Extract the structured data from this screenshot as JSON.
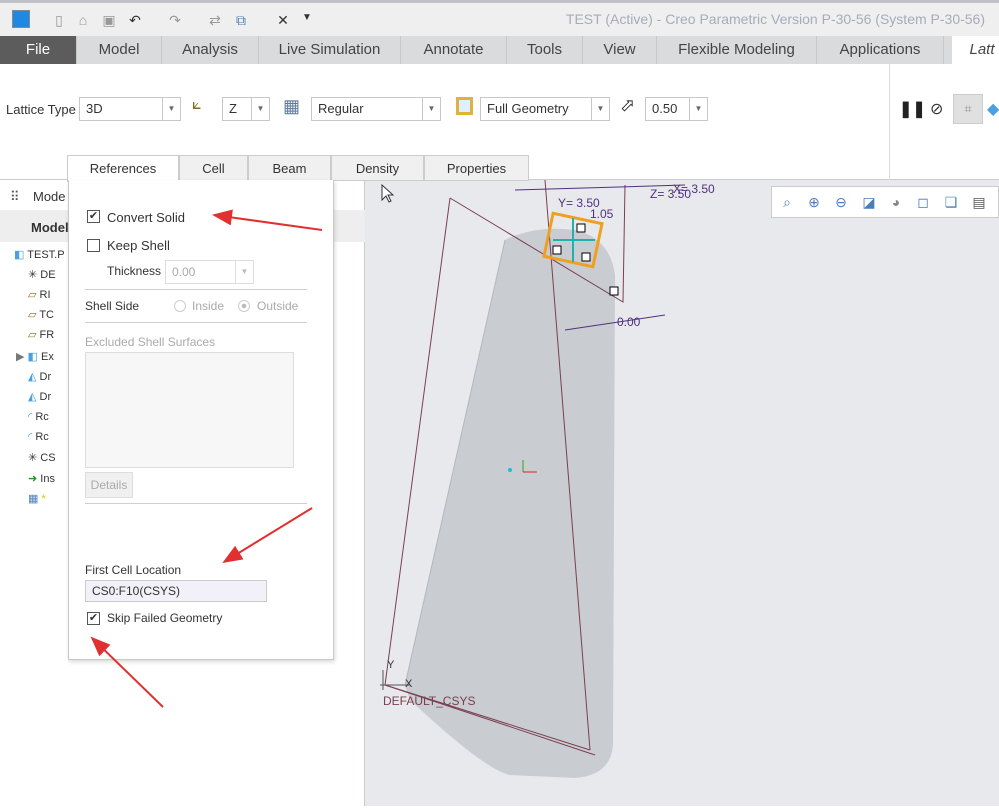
{
  "window": {
    "title": "TEST (Active) - Creo Parametric Version P-30-56 (System P-30-56)"
  },
  "tabs": [
    "File",
    "Model",
    "Analysis",
    "Live Simulation",
    "Annotate",
    "Tools",
    "View",
    "Flexible Modeling",
    "Applications",
    "Latt"
  ],
  "ribbon": {
    "lattice_type_label": "Lattice Type",
    "lattice_type": "3D",
    "direction": "Z",
    "cell_type": "Regular",
    "geometry": "Full Geometry",
    "scale": "0.50"
  },
  "panel_tabs": [
    "References",
    "Cell",
    "Beam",
    "Density",
    "Properties"
  ],
  "references": {
    "convert_solid": "Convert Solid",
    "convert_solid_checked": true,
    "keep_shell": "Keep Shell",
    "keep_shell_checked": false,
    "thickness_label": "Thickness",
    "thickness": "0.00",
    "shell_side_label": "Shell Side",
    "inside": "Inside",
    "outside": "Outside",
    "shell_side_selected": "Outside",
    "excluded_label": "Excluded Shell Surfaces",
    "details": "Details",
    "first_cell_label": "First Cell Location",
    "first_cell_value": "CS0:F10(CSYS)",
    "skip_failed": "Skip Failed Geometry",
    "skip_failed_checked": true
  },
  "tree": {
    "header": "Mode",
    "tab": "Model",
    "items": [
      "TEST.P",
      "DE",
      "RI",
      "TC",
      "FR",
      "Ex",
      "Dr",
      "Dr",
      "Rc",
      "Rc",
      "CS",
      "Ins",
      "*"
    ]
  },
  "viewport": {
    "dims": [
      "Y= 3.50",
      "Z= 3.50",
      "X= 3.50",
      "1.05",
      "0.00"
    ],
    "csys": "DEFAULT_CSYS",
    "axis_x": "X",
    "axis_y": "Y"
  },
  "colors": {
    "file_tab": "#5c5c5c",
    "arrow": "#e03030",
    "lattice": "#f0a020"
  }
}
